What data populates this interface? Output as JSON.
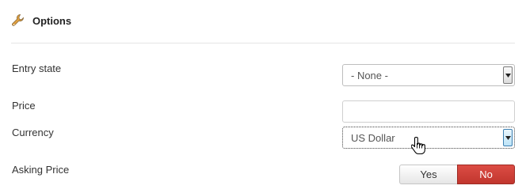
{
  "section": {
    "title": "Options",
    "icon": "wrench-icon"
  },
  "fields": {
    "entry_state": {
      "label": "Entry state",
      "selected": "- None -"
    },
    "price": {
      "label": "Price",
      "value": ""
    },
    "currency": {
      "label": "Currency",
      "selected": "US Dollar"
    },
    "asking_price": {
      "label": "Asking Price",
      "yes_label": "Yes",
      "no_label": "No",
      "selected": "No"
    }
  },
  "colors": {
    "no_active": "#c9413a",
    "focus_arrow": "#bde4f7"
  }
}
